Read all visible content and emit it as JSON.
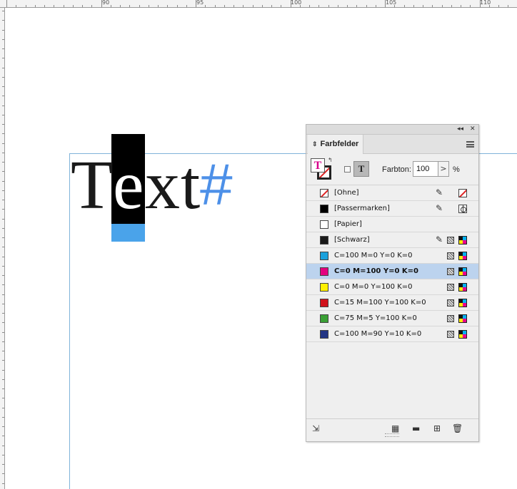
{
  "ruler": {
    "labels": [
      "90",
      "95",
      "100",
      "105",
      "110"
    ]
  },
  "canvas": {
    "text": "Text",
    "chars": [
      "T",
      "e",
      "x",
      "t"
    ],
    "hash": "#"
  },
  "panel": {
    "title": "Farbfelder",
    "collapse_glyph": "◂◂",
    "close_glyph": "✕",
    "tint_label": "Farbton:",
    "tint_value": "100",
    "tint_arrow": ">",
    "tint_unit": "%",
    "apply_text_glyph": "T",
    "swatches": [
      {
        "name": "[Ohne]",
        "color": "none",
        "icons": [
          "noedit",
          "none"
        ]
      },
      {
        "name": "[Passermarken]",
        "color": "#000000",
        "icons": [
          "noedit",
          "registration"
        ]
      },
      {
        "name": "[Papier]",
        "color": "#ffffff",
        "icons": []
      },
      {
        "name": "[Schwarz]",
        "color": "#1a1a1a",
        "icons": [
          "noedit",
          "process",
          "cmyk"
        ]
      },
      {
        "name": "C=100 M=0 Y=0 K=0",
        "color": "#1ba1dc",
        "icons": [
          "process",
          "cmyk"
        ]
      },
      {
        "name": "C=0 M=100 Y=0 K=0",
        "color": "#e4007f",
        "icons": [
          "process",
          "cmyk"
        ],
        "selected": true
      },
      {
        "name": "C=0 M=0 Y=100 K=0",
        "color": "#fff000",
        "icons": [
          "process",
          "cmyk"
        ]
      },
      {
        "name": "C=15 M=100 Y=100 K=0",
        "color": "#d0121b",
        "icons": [
          "process",
          "cmyk"
        ]
      },
      {
        "name": "C=75 M=5 Y=100 K=0",
        "color": "#3aa035",
        "icons": [
          "process",
          "cmyk"
        ]
      },
      {
        "name": "C=100 M=90 Y=10 K=0",
        "color": "#233584",
        "icons": [
          "process",
          "cmyk"
        ]
      }
    ]
  }
}
